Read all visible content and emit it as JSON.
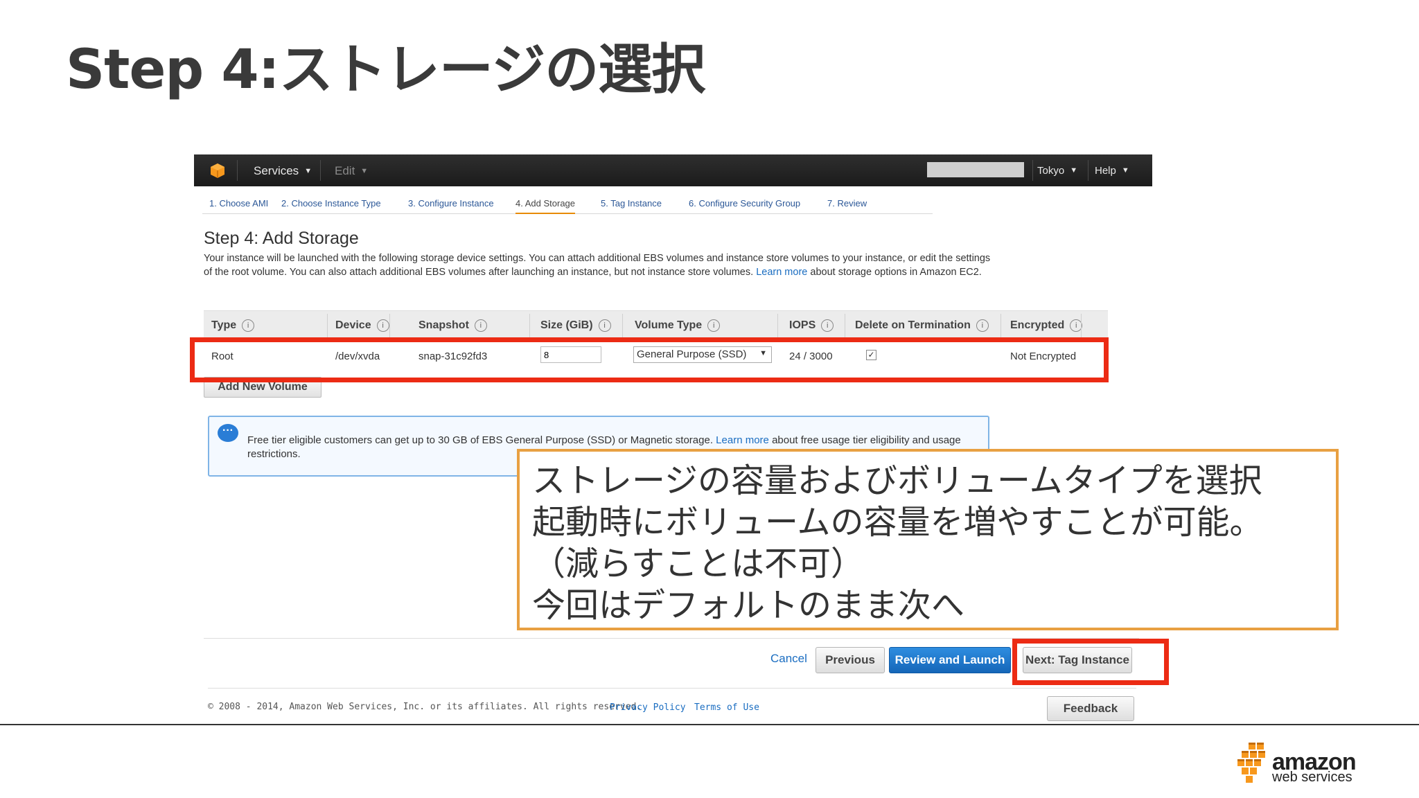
{
  "slide": {
    "title": "Step 4:ストレージの選択"
  },
  "navbar": {
    "services": "Services",
    "edit": "Edit",
    "region": "Tokyo",
    "help": "Help"
  },
  "wizard": {
    "tabs": [
      {
        "label": "1. Choose AMI"
      },
      {
        "label": "2. Choose Instance Type"
      },
      {
        "label": "3. Configure Instance"
      },
      {
        "label": "4. Add Storage"
      },
      {
        "label": "5. Tag Instance"
      },
      {
        "label": "6. Configure Security Group"
      },
      {
        "label": "7. Review"
      }
    ],
    "active_tab": "4. Add Storage"
  },
  "page": {
    "heading": "Step 4: Add Storage",
    "intro_text": "Your instance will be launched with the following storage device settings. You can attach additional EBS volumes and instance store volumes to your instance, or edit the settings of the root volume. You can also attach additional EBS volumes after launching an instance, but not instance store volumes.",
    "intro_link": "Learn more",
    "intro_tail": "about storage options in Amazon EC2."
  },
  "table": {
    "headers": [
      "Type",
      "Device",
      "Snapshot",
      "Size (GiB)",
      "Volume Type",
      "IOPS",
      "Delete on Termination",
      "Encrypted"
    ],
    "row": {
      "type": "Root",
      "device": "/dev/xvda",
      "snapshot": "snap-31c92fd3",
      "size": "8",
      "volume_type": "General Purpose (SSD)",
      "iops": "24 / 3000",
      "delete_on_termination": true,
      "encrypted": "Not Encrypted"
    }
  },
  "add_volume_label": "Add New Volume",
  "notice": {
    "text": "Free tier eligible customers can get up to 30 GB of EBS General Purpose (SSD) or Magnetic storage.",
    "link": "Learn more",
    "tail": "about free usage tier eligibility and usage restrictions."
  },
  "actions": {
    "cancel": "Cancel",
    "previous": "Previous",
    "review_and_launch": "Review and Launch",
    "next": "Next: Tag Instance"
  },
  "footer": {
    "copyright": "© 2008 - 2014, Amazon Web Services, Inc. or its affiliates. All rights reserved.",
    "privacy": "Privacy Policy",
    "terms": "Terms of Use",
    "feedback": "Feedback"
  },
  "callout": {
    "lines": [
      "ストレージの容量およびボリュームタイプを選択",
      "起動時にボリュームの容量を増やすことが可能。",
      "（減らすことは不可）",
      "今回はデフォルトのまま次へ"
    ]
  },
  "logo": {
    "word": "amazon",
    "sub": "web services"
  },
  "colors": {
    "highlight_red": "#ec2b14",
    "callout_border": "#e8a042",
    "primary_blue": "#1566b8",
    "link_blue": "#1a6dc1"
  }
}
